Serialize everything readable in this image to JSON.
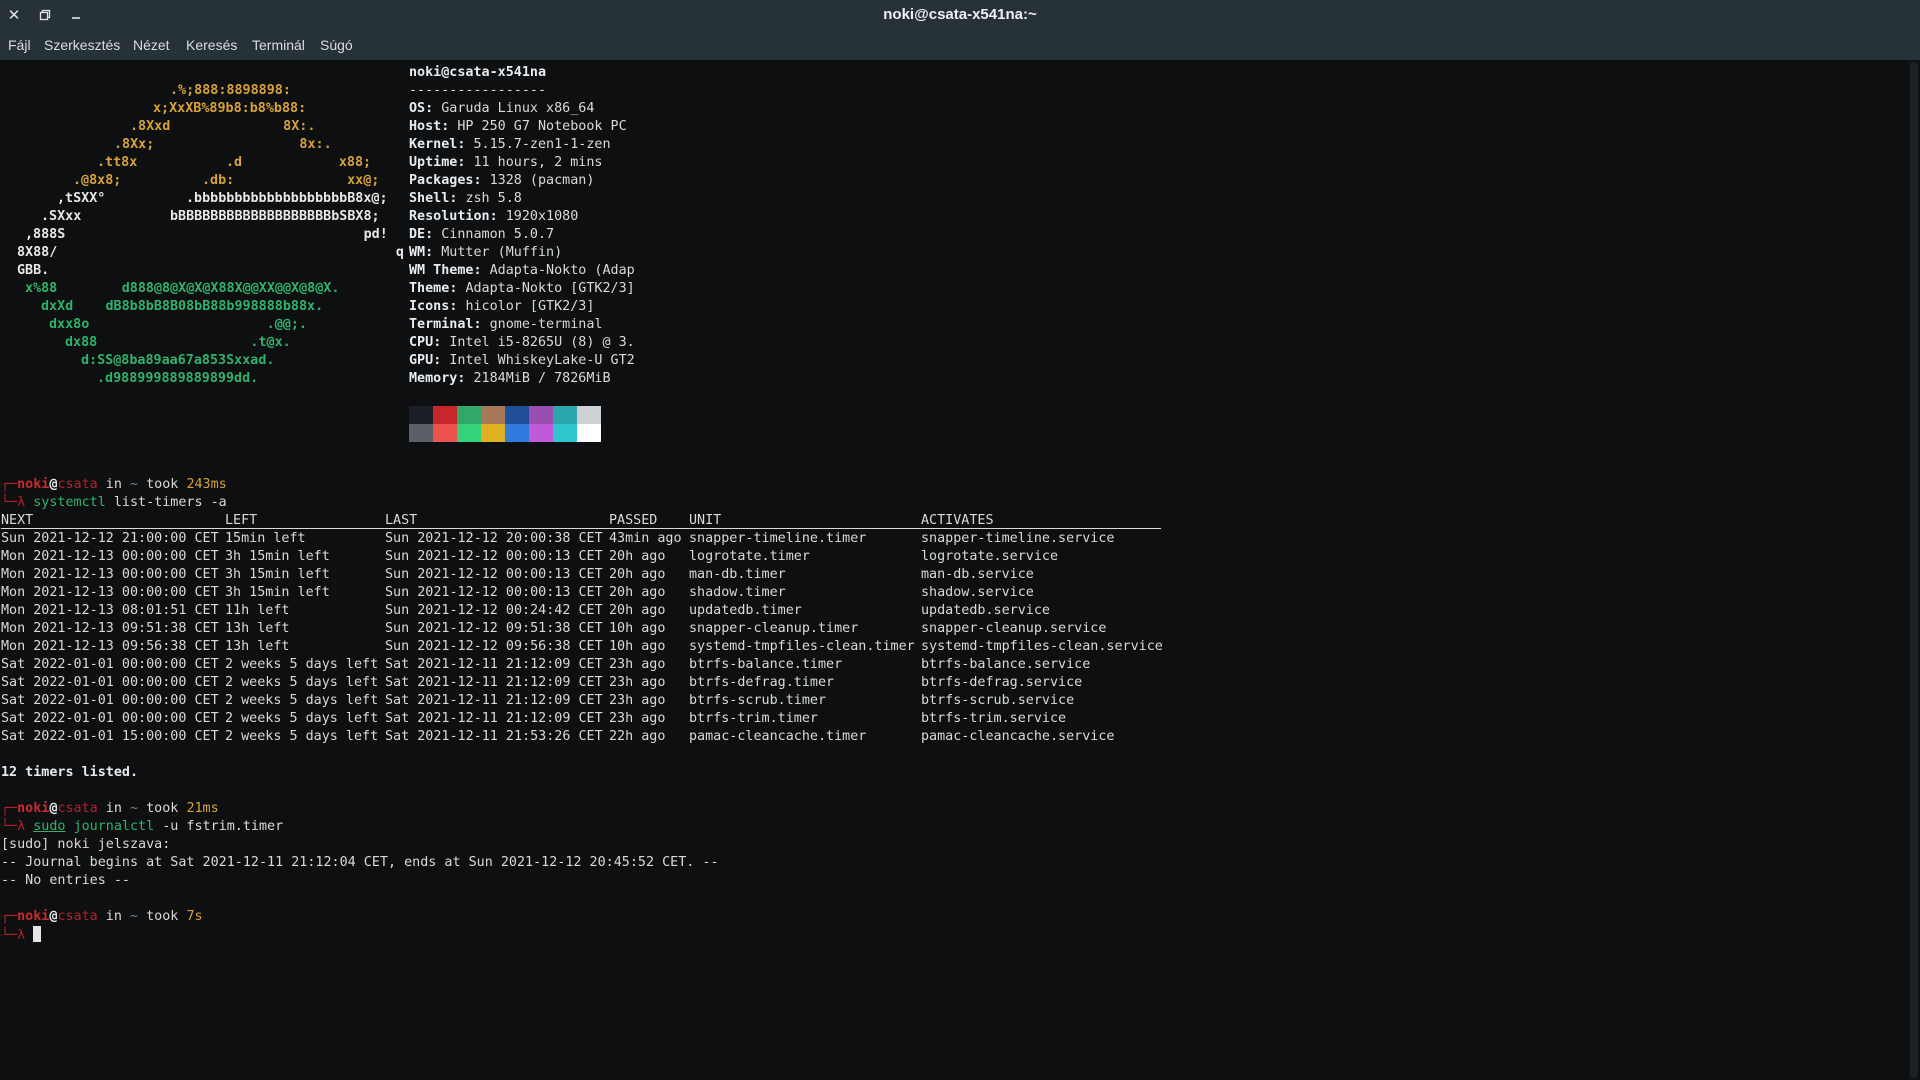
{
  "window": {
    "title": "noki@csata-x541na:~",
    "close_icon": "close-icon",
    "restore_icon": "restore-icon",
    "minimize_icon": "minimize-icon"
  },
  "menu": [
    "Fájl",
    "Szerkesztés",
    "Nézet",
    "Keresés",
    "Terminál",
    "Súgó"
  ],
  "neofetch": {
    "logo": [
      ".%;888:8898898:",
      "x;XxXB%89b8:b8%b88:",
      ".8Xxd              8X:.",
      ".8Xx;                  8x:.",
      ".tt8x           .d            x88;",
      ".@8x8;          .db:              xx@;",
      ",tSXX°          .bbbbbbbbbbbbbbbbbbbB8x@;",
      ".SXxx           bBBBBBBBBBBBBBBBBBBBbSBX8;",
      ",888S                                     pd!",
      "8X88/                                          q",
      "GBB.",
      "x%88        d888@8@X@X@X88X@@XX@@X@8@X.",
      "dxXd    dB8b8bB8B08bB88b998888b88x.",
      "dxx8o                      .@@;.",
      "dx88                   .t@x.",
      "d:SS@8ba89aa67a853Sxxad.",
      ".d988999889889899dd."
    ],
    "user_host": "noki@csata-x541na",
    "separator": "-----------------",
    "info": [
      {
        "key": "OS",
        "value": "Garuda Linux x86_64"
      },
      {
        "key": "Host",
        "value": "HP 250 G7 Notebook PC"
      },
      {
        "key": "Kernel",
        "value": "5.15.7-zen1-1-zen"
      },
      {
        "key": "Uptime",
        "value": "11 hours, 2 mins"
      },
      {
        "key": "Packages",
        "value": "1328 (pacman)"
      },
      {
        "key": "Shell",
        "value": "zsh 5.8"
      },
      {
        "key": "Resolution",
        "value": "1920x1080"
      },
      {
        "key": "DE",
        "value": "Cinnamon 5.0.7"
      },
      {
        "key": "WM",
        "value": "Mutter (Muffin)"
      },
      {
        "key": "WM Theme",
        "value": "Adapta-Nokto (Adap"
      },
      {
        "key": "Theme",
        "value": "Adapta-Nokto [GTK2/3]"
      },
      {
        "key": "Icons",
        "value": "hicolor [GTK2/3]"
      },
      {
        "key": "Terminal",
        "value": "gnome-terminal"
      },
      {
        "key": "CPU",
        "value": "Intel i5-8265U (8) @ 3."
      },
      {
        "key": "GPU",
        "value": "Intel WhiskeyLake-U GT2"
      },
      {
        "key": "Memory",
        "value": "2184MiB / 7826MiB"
      }
    ],
    "palette_top": [
      "#1c1f26",
      "#c9252c",
      "#2fa86a",
      "#a7795a",
      "#1f4f9a",
      "#9a4fb0",
      "#2aa6ac",
      "#cfd2d4"
    ],
    "palette_bottom": [
      "#5b6066",
      "#ef5350",
      "#34d27a",
      "#e0b020",
      "#2f7be0",
      "#c05ad6",
      "#30c6d0",
      "#ffffff"
    ]
  },
  "prompts": [
    {
      "user": "noki",
      "at": "@",
      "host": "csata",
      "in": " in ",
      "dir": "~",
      "took": " took ",
      "time": "243ms",
      "arrow": "└─λ",
      "corner": "┌─",
      "cmd_name": "systemctl",
      "cmd_args": " list-timers -a"
    },
    {
      "user": "noki",
      "at": "@",
      "host": "csata",
      "in": " in ",
      "dir": "~",
      "took": " took ",
      "time": "21ms",
      "arrow": "└─λ",
      "corner": "┌─",
      "cmd_sudo": "sudo",
      "cmd_name": "journalctl",
      "cmd_args": " -u fstrim.timer"
    },
    {
      "user": "noki",
      "at": "@",
      "host": "csata",
      "in": " in ",
      "dir": "~",
      "took": " took ",
      "time": "7s",
      "arrow": "└─λ",
      "corner": "┌─"
    }
  ],
  "timers": {
    "headers": [
      "NEXT",
      "LEFT",
      "LAST",
      "PASSED",
      "UNIT",
      "ACTIVATES"
    ],
    "rows": [
      [
        "Sun 2021-12-12 21:00:00 CET",
        "15min left",
        "Sun 2021-12-12 20:00:38 CET",
        "43min ago",
        "snapper-timeline.timer",
        "snapper-timeline.service"
      ],
      [
        "Mon 2021-12-13 00:00:00 CET",
        "3h 15min left",
        "Sun 2021-12-12 00:00:13 CET",
        "20h ago",
        "logrotate.timer",
        "logrotate.service"
      ],
      [
        "Mon 2021-12-13 00:00:00 CET",
        "3h 15min left",
        "Sun 2021-12-12 00:00:13 CET",
        "20h ago",
        "man-db.timer",
        "man-db.service"
      ],
      [
        "Mon 2021-12-13 00:00:00 CET",
        "3h 15min left",
        "Sun 2021-12-12 00:00:13 CET",
        "20h ago",
        "shadow.timer",
        "shadow.service"
      ],
      [
        "Mon 2021-12-13 08:01:51 CET",
        "11h left",
        "Sun 2021-12-12 00:24:42 CET",
        "20h ago",
        "updatedb.timer",
        "updatedb.service"
      ],
      [
        "Mon 2021-12-13 09:51:38 CET",
        "13h left",
        "Sun 2021-12-12 09:51:38 CET",
        "10h ago",
        "snapper-cleanup.timer",
        "snapper-cleanup.service"
      ],
      [
        "Mon 2021-12-13 09:56:38 CET",
        "13h left",
        "Sun 2021-12-12 09:56:38 CET",
        "10h ago",
        "systemd-tmpfiles-clean.timer",
        "systemd-tmpfiles-clean.service"
      ],
      [
        "Sat 2022-01-01 00:00:00 CET",
        "2 weeks 5 days left",
        "Sat 2021-12-11 21:12:09 CET",
        "23h ago",
        "btrfs-balance.timer",
        "btrfs-balance.service"
      ],
      [
        "Sat 2022-01-01 00:00:00 CET",
        "2 weeks 5 days left",
        "Sat 2021-12-11 21:12:09 CET",
        "23h ago",
        "btrfs-defrag.timer",
        "btrfs-defrag.service"
      ],
      [
        "Sat 2022-01-01 00:00:00 CET",
        "2 weeks 5 days left",
        "Sat 2021-12-11 21:12:09 CET",
        "23h ago",
        "btrfs-scrub.timer",
        "btrfs-scrub.service"
      ],
      [
        "Sat 2022-01-01 00:00:00 CET",
        "2 weeks 5 days left",
        "Sat 2021-12-11 21:12:09 CET",
        "23h ago",
        "btrfs-trim.timer",
        "btrfs-trim.service"
      ],
      [
        "Sat 2022-01-01 15:00:00 CET",
        "2 weeks 5 days left",
        "Sat 2021-12-11 21:53:26 CET",
        "22h ago",
        "pamac-cleancache.timer",
        "pamac-cleancache.service"
      ]
    ],
    "summary": "12 timers listed."
  },
  "journal_output": [
    "[sudo] noki jelszava:",
    "-- Journal begins at Sat 2021-12-11 21:12:04 CET, ends at Sun 2021-12-12 20:45:52 CET. --",
    "-- No entries --"
  ]
}
